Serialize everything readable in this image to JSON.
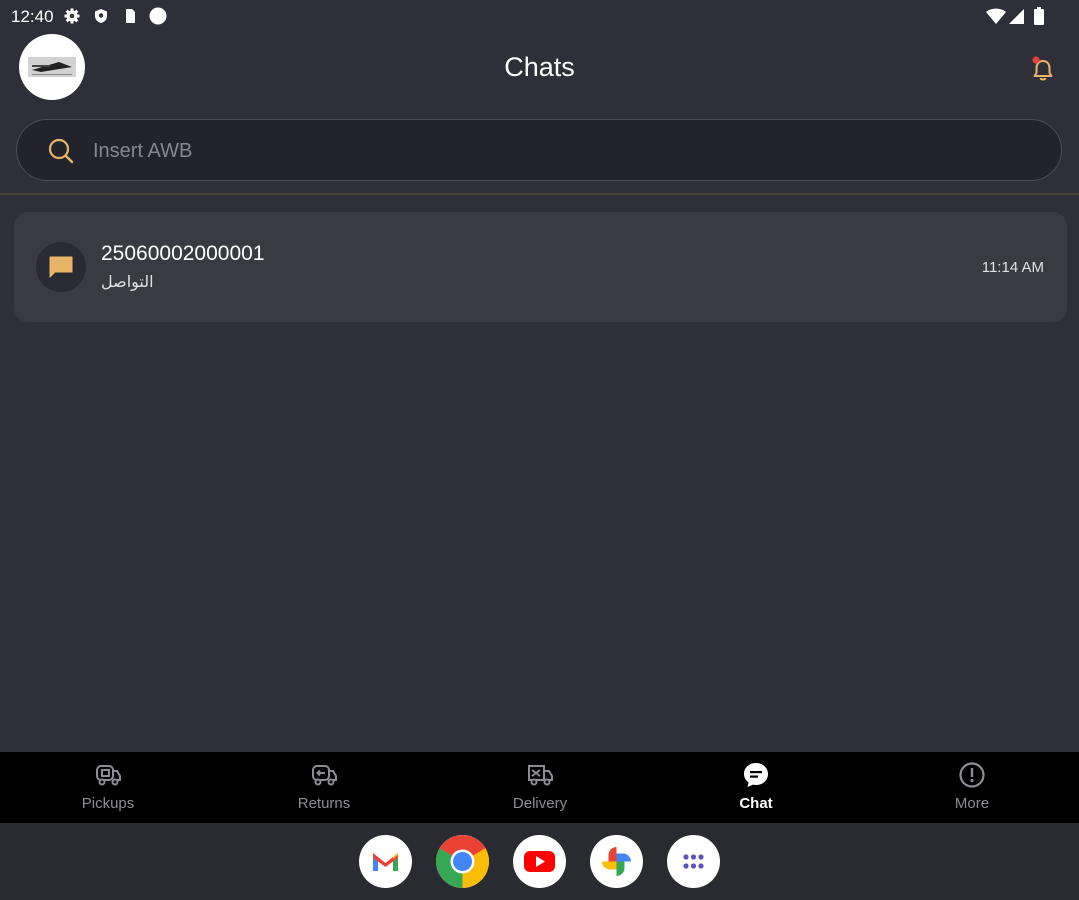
{
  "status_bar": {
    "time": "12:40"
  },
  "header": {
    "title": "Chats"
  },
  "search": {
    "placeholder": "Insert AWB"
  },
  "chats": [
    {
      "title": "25060002000001",
      "subtitle": "التواصل",
      "time": "11:14 AM"
    }
  ],
  "nav": {
    "items": [
      {
        "label": "Pickups",
        "icon": "pickup-truck-icon"
      },
      {
        "label": "Returns",
        "icon": "return-truck-icon"
      },
      {
        "label": "Delivery",
        "icon": "delivery-truck-icon"
      },
      {
        "label": "Chat",
        "icon": "chat-bubble-icon",
        "active": true
      },
      {
        "label": "More",
        "icon": "info-circle-icon"
      }
    ]
  },
  "dock": {
    "apps": [
      "gmail-icon",
      "chrome-icon",
      "youtube-icon",
      "photos-icon",
      "app-drawer-icon"
    ]
  },
  "colors": {
    "background": "#2e2f38",
    "accent": "#e8b46a",
    "card": "#393a42",
    "nav_background": "#000000",
    "notification_dot": "#e0443a"
  }
}
